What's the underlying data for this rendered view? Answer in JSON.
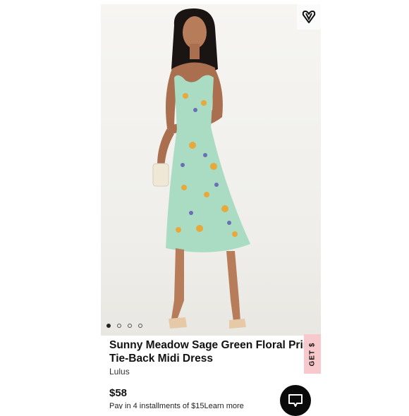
{
  "product": {
    "title_line1": "Sunny Meadow Sage Green Floral Prin",
    "title_line2": "Tie-Back Midi Dress",
    "brand": "Lulus",
    "price": "$58",
    "installments_text": "Pay in 4 installments of  $15",
    "learn_more": "Learn more"
  },
  "carousel": {
    "slide_count": 4,
    "active_index": 0
  },
  "side_tab": {
    "label": "GET $"
  },
  "icons": {
    "like": "heart-v-icon",
    "chat": "chat-bubble-icon"
  },
  "colors": {
    "side_tab_bg": "#f7c9cc",
    "chat_bg": "#0a0a0a",
    "dress": "#a9dcc3"
  }
}
